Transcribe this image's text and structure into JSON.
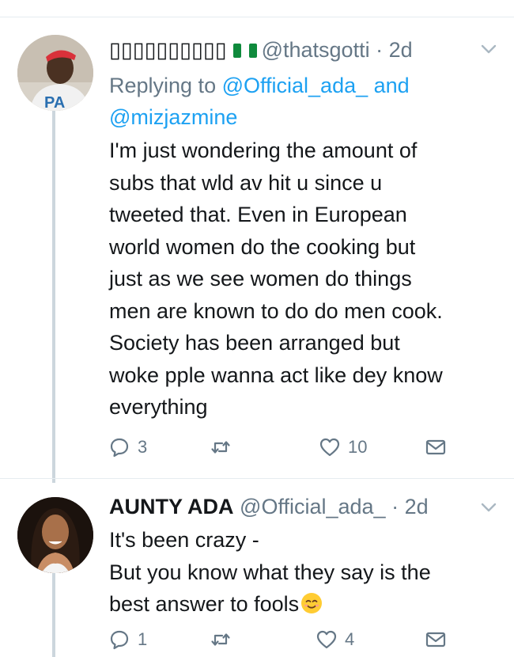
{
  "tweets": [
    {
      "display_name": "▯▯▯▯▯▯▯▯▯▯",
      "handle": "@thatsgotti",
      "sep": "·",
      "time": "2d",
      "reply_prefix": "Replying to ",
      "reply_to_1": "@Official_ada_",
      "reply_and": " and",
      "reply_to_2": "@mizjazmine",
      "text": "I'm just wondering the amount of\nsubs that wld av hit u since u\ntweeted that. Even in European\nworld women do the cooking but\njust as we see women do things\nmen are known to do do men cook.\nSociety has been arranged but\nwoke pple wanna act like dey know\neverything",
      "replies": "3",
      "retweets": "",
      "likes": "10",
      "avatar_text": "PA"
    },
    {
      "display_name": "AUNTY ADA",
      "handle": "@Official_ada_",
      "sep": "·",
      "time": "2d",
      "text": "It's been crazy -\nBut you know what they say is the\nbest answer to fools",
      "replies": "1",
      "retweets": "",
      "likes": "4"
    }
  ],
  "icons": {
    "reply": "reply-icon",
    "retweet": "retweet-icon",
    "like": "heart-icon",
    "dm": "envelope-icon",
    "more": "chevron-down-icon",
    "flag": "nigeria-flag-icon",
    "emoji": "smiling-face-icon"
  },
  "colors": {
    "link": "#1da1f2",
    "muted": "#657786",
    "text": "#14171a",
    "thread": "#ccd6dd"
  }
}
